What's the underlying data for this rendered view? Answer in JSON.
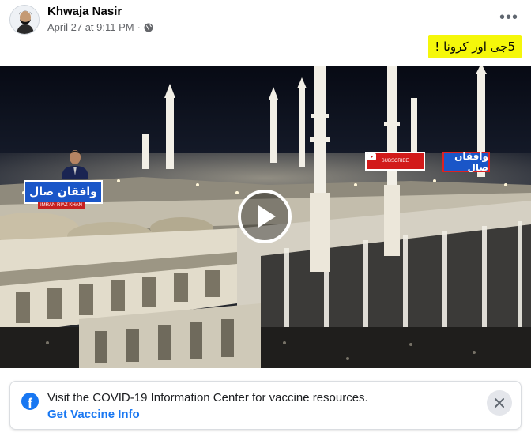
{
  "post": {
    "author": "Khwaja Nasir",
    "timestamp": "April 27 at 9:11 PM",
    "separator": "·",
    "privacy_icon": "globe-icon",
    "more_icon": "more-options-icon",
    "more_label": "•••",
    "text": "5جی اور کرونا !",
    "text_highlight_color": "#f5f70a"
  },
  "video": {
    "play_icon": "play-icon",
    "channel_logo_text": "وافقان صال",
    "channel_logo_small_text": "وافقان صال",
    "anchor_caption": "IMRAN RIAZ KHAN",
    "youtube_badge_text": "SUBSCRIBE"
  },
  "covid_card": {
    "icon": "facebook-icon",
    "fb_letter": "f",
    "message": "Visit the COVID-19 Information Center for vaccine resources.",
    "link_label": "Get Vaccine Info",
    "close_icon": "close-icon"
  },
  "colors": {
    "link": "#1877f2",
    "meta": "#65676b",
    "logo_blue": "#1a56c8",
    "youtube_red": "#d21a1a"
  }
}
